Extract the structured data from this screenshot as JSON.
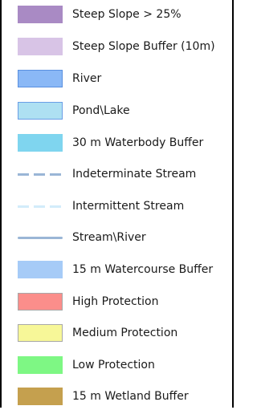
{
  "legend": {
    "items": [
      {
        "label": "Steep Slope > 25%",
        "kind": "area",
        "fill": "#a98ac4",
        "border": "#a98ac4"
      },
      {
        "label": "Steep Slope Buffer (10m)",
        "kind": "area",
        "fill": "#d8c4e6",
        "border": "#d8c4e6"
      },
      {
        "label": "River",
        "kind": "area",
        "fill": "#8ab8f6",
        "border": "#5a90e0"
      },
      {
        "label": "Pond\\Lake",
        "kind": "area",
        "fill": "#aee0f2",
        "border": "#6a9ee6"
      },
      {
        "label": "30 m Waterbody Buffer",
        "kind": "area",
        "fill": "#7fd5ef",
        "border": "#7fd5ef"
      },
      {
        "label": "Indeterminate Stream",
        "kind": "dashed",
        "fill": "#9ab6d6",
        "border": "#9ab6d6"
      },
      {
        "label": "Intermittent Stream",
        "kind": "dashed",
        "fill": "#d2ecfa",
        "border": "#d2ecfa"
      },
      {
        "label": "Stream\\River",
        "kind": "solid",
        "fill": "#9ab6d6",
        "border": "#9ab6d6"
      },
      {
        "label": "15 m Watercourse Buffer",
        "kind": "area",
        "fill": "#a6cbf7",
        "border": "#a6cbf7"
      },
      {
        "label": "High Protection",
        "kind": "area",
        "fill": "#fb8e8b",
        "border": "#a8a8a8"
      },
      {
        "label": "Medium Protection",
        "kind": "area",
        "fill": "#f7f798",
        "border": "#a8a8a8"
      },
      {
        "label": "Low Protection",
        "kind": "area",
        "fill": "#7ef784",
        "border": "#7ef784"
      },
      {
        "label": "15 m Wetland Buffer",
        "kind": "area",
        "fill": "#c5a04e",
        "border": "#c5a04e"
      }
    ]
  }
}
